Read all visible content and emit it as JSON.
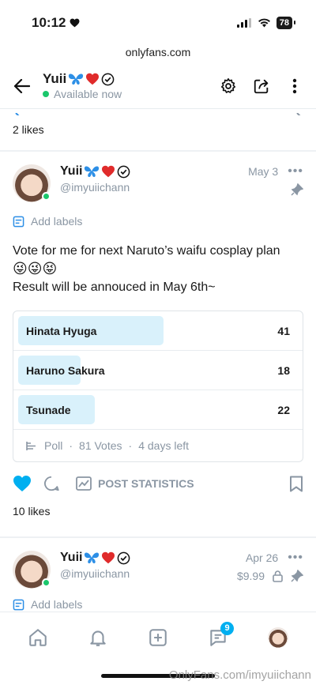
{
  "status_bar": {
    "time": "10:12",
    "battery": "78"
  },
  "url": "onlyfans.com",
  "header": {
    "name": "Yuii",
    "status": "Available now"
  },
  "prev_post": {
    "likes": "2 likes"
  },
  "post1": {
    "name": "Yuii",
    "handle": "@imyuiichann",
    "date": "May 3",
    "add_labels": "Add labels",
    "text_line1": "Vote for me for next Naruto’s waifu cosplay plan",
    "emojis": "😜😜😝",
    "text_line2": "Result will be annouced in May 6th~",
    "poll": {
      "options": [
        {
          "label": "Hinata Hyuga",
          "count": "41",
          "fraction": 0.51
        },
        {
          "label": "Haruno Sakura",
          "count": "18",
          "fraction": 0.22
        },
        {
          "label": "Tsunade",
          "count": "22",
          "fraction": 0.27
        }
      ],
      "type": "Poll",
      "votes": "81 Votes",
      "time_left": "4 days left"
    },
    "post_statistics": "POST STATISTICS",
    "likes": "10 likes"
  },
  "post2": {
    "name": "Yuii",
    "handle": "@imyuiichann",
    "date": "Apr 26",
    "price": "$9.99",
    "add_labels": "Add labels"
  },
  "tabbar": {
    "messages_badge": "9"
  },
  "watermark": "OnlyFans.com/imyuiichann",
  "colors": {
    "accent": "#00aff0",
    "online": "#1bc76c",
    "heart": "#e02b2b",
    "poll_fill": "#d9f1fb"
  }
}
